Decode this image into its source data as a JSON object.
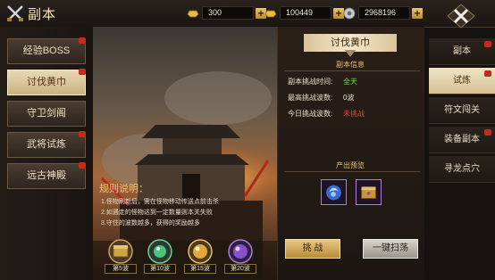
{
  "header": {
    "title": "副本"
  },
  "resources": [
    {
      "icon": "gold-ingot-icon",
      "value": "300"
    },
    {
      "icon": "gold-ingot-icon",
      "value": "100449"
    },
    {
      "icon": "silver-coin-icon",
      "value": "2968196"
    }
  ],
  "left_menu": [
    {
      "label": "经验BOSS",
      "active": false
    },
    {
      "label": "讨伐黄巾",
      "active": true
    },
    {
      "label": "守卫剑阁",
      "active": false
    },
    {
      "label": "武将试炼",
      "active": false
    },
    {
      "label": "远古神殿",
      "active": false
    }
  ],
  "rules": {
    "title": "规则说明：",
    "items": [
      "1.怪物刷新后，需在怪物移动传送点前击杀",
      "2.如遇走的怪物达到一定数量则本关失败",
      "3.守住的波数越多，获得的奖励越多"
    ]
  },
  "wave_rewards": [
    {
      "label": "第5波",
      "count": ""
    },
    {
      "label": "第10波",
      "count": ""
    },
    {
      "label": "第15波",
      "count": ""
    },
    {
      "label": "第20波",
      "count": ""
    }
  ],
  "panel": {
    "title": "讨伐黄巾",
    "info_title": "副本信息",
    "info": [
      {
        "label": "副本挑战时间:",
        "value": "全天",
        "color": "#7ed957"
      },
      {
        "label": "最高挑战波数:",
        "value": "0波",
        "color": "#e6dccb"
      },
      {
        "label": "今日挑战波数:",
        "value": "未挑战",
        "color": "#e0463a"
      }
    ],
    "preview_title": "产出预览",
    "challenge_label": "挑 战",
    "sweep_label": "一键扫荡"
  },
  "right_tabs": [
    {
      "label": "副本",
      "active": false
    },
    {
      "label": "试炼",
      "active": true
    },
    {
      "label": "符文闯关",
      "active": false
    },
    {
      "label": "装备副本",
      "active": false
    },
    {
      "label": "寻龙点穴",
      "active": false
    }
  ]
}
